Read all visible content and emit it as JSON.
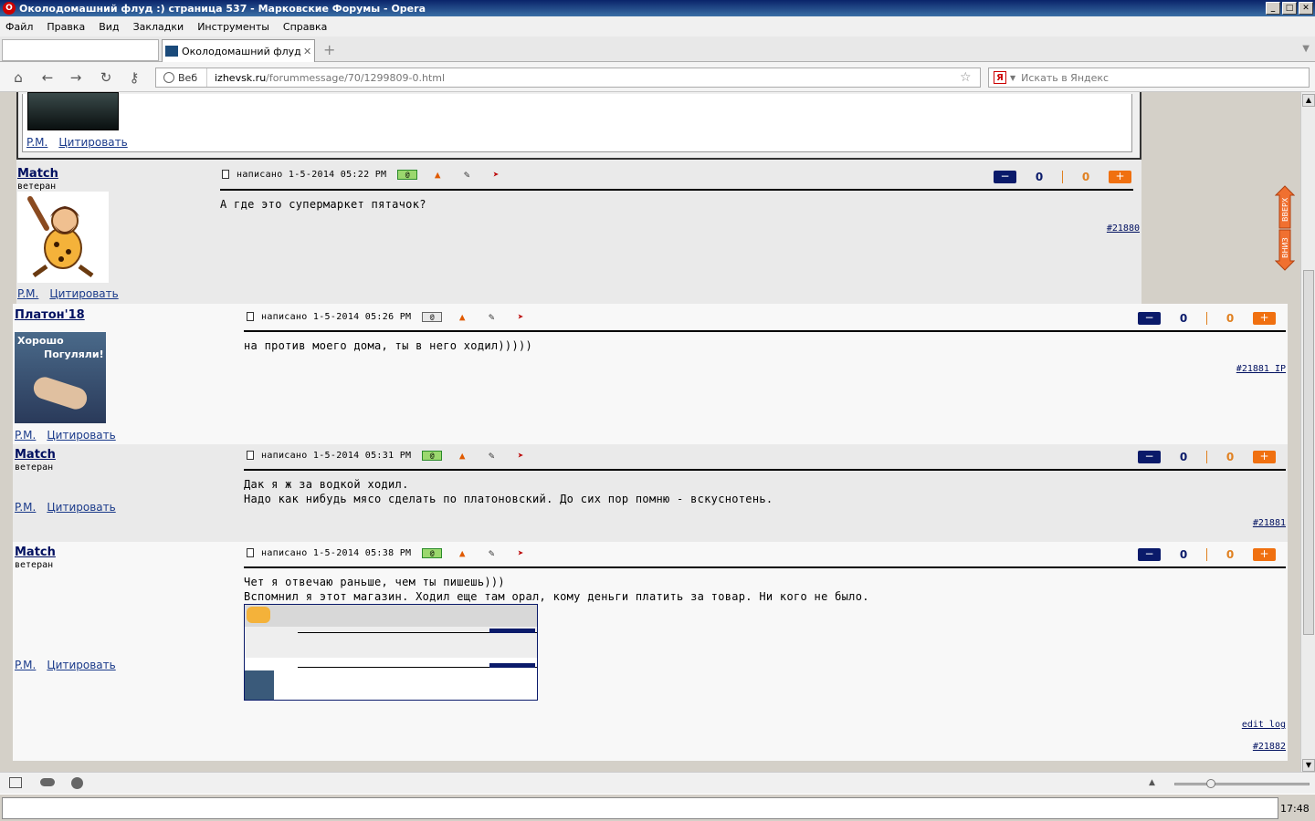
{
  "window": {
    "title": "Околодомашний флуд :) страница 537 - Марковские Форумы - Opera"
  },
  "menu": [
    "Файл",
    "Правка",
    "Вид",
    "Закладки",
    "Инструменты",
    "Справка"
  ],
  "tab": {
    "title": "Околодомашний флуд :..."
  },
  "address": {
    "web_label": "Веб",
    "url_host": "izhevsk.ru",
    "url_path": "/forummessage/70/1299809-0.html"
  },
  "search": {
    "placeholder": "Искать в Яндекс"
  },
  "labels": {
    "pm": "P.M.",
    "quote": "Цитировать",
    "written": "написано",
    "ip": "IP",
    "edit_log": "edit log",
    "up": "ВВЕРХ",
    "down": "ВНИЗ"
  },
  "posts": [
    {
      "author": "Match",
      "rank": "ветеран",
      "date": "1-5-2014 05:22 PM",
      "lines": [
        "А где это супермаркет пятачок?"
      ],
      "anchor": "#21880",
      "votes_up": "0",
      "votes_down": "0"
    },
    {
      "author": "Платон'18",
      "rank": "",
      "avatar_text": [
        "Хорошо",
        "Погуляли!"
      ],
      "date": "1-5-2014 05:26 PM",
      "lines": [
        "на против моего дома, ты в него ходил)))))"
      ],
      "anchor": "#21881",
      "votes_up": "0",
      "votes_down": "0"
    },
    {
      "author": "Match",
      "rank": "ветеран",
      "date": "1-5-2014 05:31 PM",
      "lines": [
        "Дак я ж за водкой ходил.",
        "Надо как нибудь мясо сделать по платоновский. До сих пор помню - вскуснотень."
      ],
      "anchor": "#21881",
      "votes_up": "0",
      "votes_down": "0"
    },
    {
      "author": "Match",
      "rank": "ветеран",
      "date": "1-5-2014 05:38 PM",
      "lines": [
        "Чет я отвечаю раньше, чем ты пишешь)))",
        "Вспомнил я этот магазин. Ходил еще там орал, кому деньги платить за товар. Ни кого не было."
      ],
      "anchor": "#21882",
      "votes_up": "0",
      "votes_down": "0"
    }
  ],
  "taskbar": {
    "clock": "17:48"
  }
}
